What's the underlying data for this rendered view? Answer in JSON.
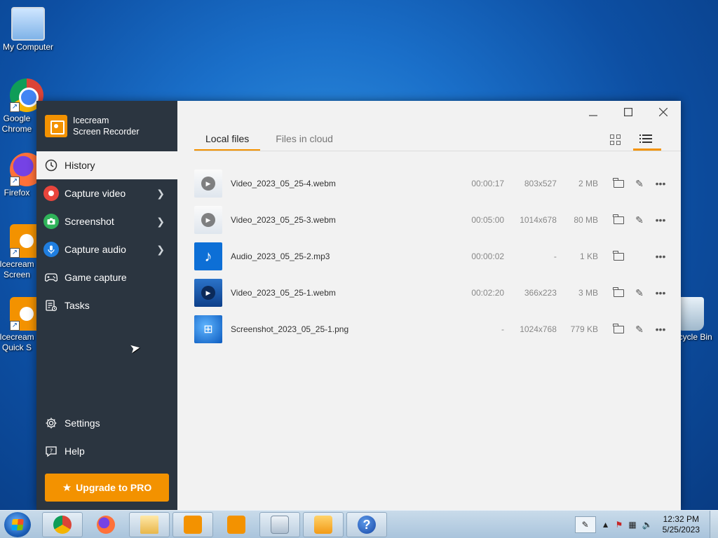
{
  "desktop": {
    "icons": [
      {
        "label": "My Computer"
      },
      {
        "label": "Google Chrome"
      },
      {
        "label": "Firefox"
      },
      {
        "label": "Icecream Screen"
      },
      {
        "label": "Icecream Quick S"
      },
      {
        "label": "Recycle Bin"
      }
    ]
  },
  "app": {
    "brand_line1": "Icecream",
    "brand_line2": "Screen Recorder",
    "nav": [
      {
        "label": "History"
      },
      {
        "label": "Capture video"
      },
      {
        "label": "Screenshot"
      },
      {
        "label": "Capture audio"
      },
      {
        "label": "Game capture"
      },
      {
        "label": "Tasks"
      }
    ],
    "bottom_nav": [
      {
        "label": "Settings"
      },
      {
        "label": "Help"
      }
    ],
    "upgrade_label": "Upgrade to PRO",
    "tabs": [
      {
        "label": "Local files"
      },
      {
        "label": "Files in cloud"
      }
    ],
    "files": [
      {
        "name": "Video_2023_05_25-4.webm",
        "duration": "00:00:17",
        "resolution": "803x527",
        "size": "2 MB"
      },
      {
        "name": "Video_2023_05_25-3.webm",
        "duration": "00:05:00",
        "resolution": "1014x678",
        "size": "80 MB"
      },
      {
        "name": "Audio_2023_05_25-2.mp3",
        "duration": "00:00:02",
        "resolution": "-",
        "size": "1 KB"
      },
      {
        "name": "Video_2023_05_25-1.webm",
        "duration": "00:02:20",
        "resolution": "366x223",
        "size": "3 MB"
      },
      {
        "name": "Screenshot_2023_05_25-1.png",
        "duration": "-",
        "resolution": "1024x768",
        "size": "779 KB"
      }
    ],
    "colors": {
      "accent": "#f39200",
      "sidebar_bg": "#2b3540"
    }
  },
  "taskbar": {
    "time": "12:32 PM",
    "date": "5/25/2023"
  }
}
